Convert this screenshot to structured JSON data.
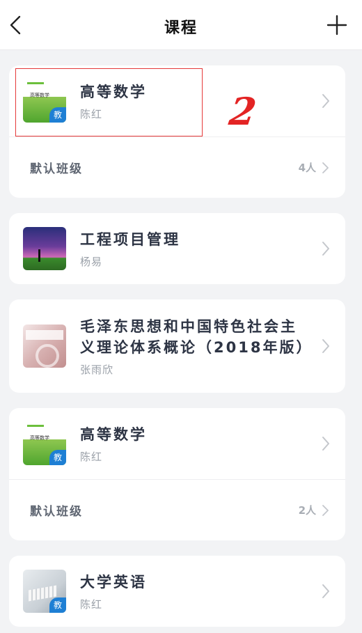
{
  "header": {
    "title": "课程",
    "back_icon": "chevron-left-icon",
    "add_icon": "plus-icon"
  },
  "courses": [
    {
      "title": "高等数学",
      "teacher": "陈红",
      "cover_badge": "教",
      "class": {
        "name": "默认班级",
        "count": "4人"
      }
    },
    {
      "title": "工程项目管理",
      "teacher": "杨易"
    },
    {
      "title": "毛泽东思想和中国特色社会主义理论体系概论（2018年版）",
      "teacher": "张雨欣"
    },
    {
      "title": "高等数学",
      "teacher": "陈红",
      "cover_badge": "教",
      "class": {
        "name": "默认班级",
        "count": "2人"
      }
    },
    {
      "title": "大学英语",
      "teacher": "陈红",
      "cover_badge": "教"
    }
  ],
  "annotation": {
    "label": "2",
    "color": "#e32424"
  },
  "colors": {
    "accent": "#1e7fd4",
    "text": "#2d3444",
    "muted": "#9aa0a8"
  }
}
